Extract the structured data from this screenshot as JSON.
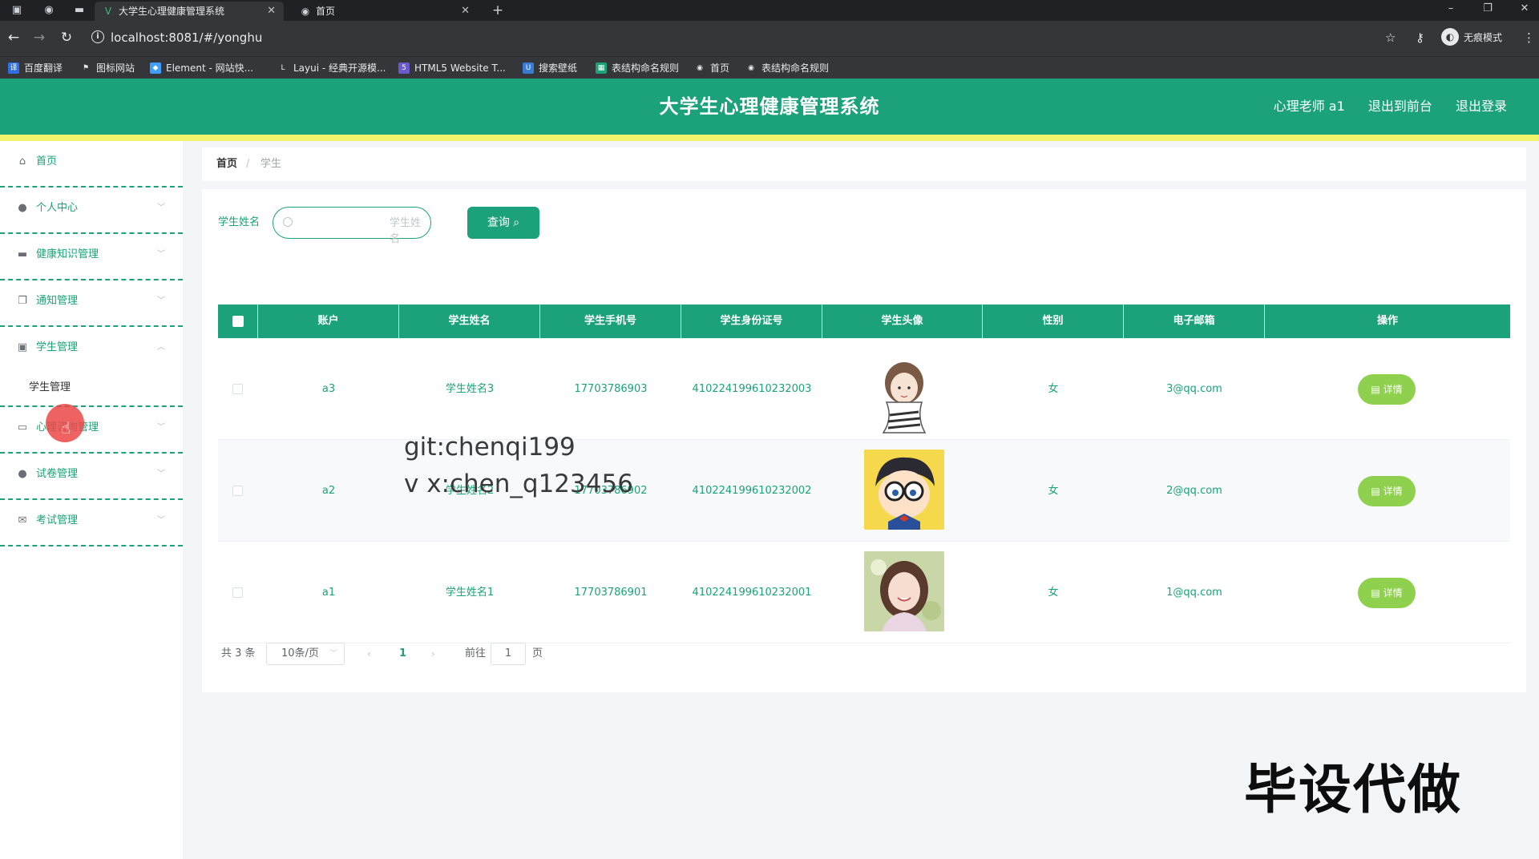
{
  "browser": {
    "tabs": [
      {
        "title": "大学生心理健康管理系统",
        "active": true
      },
      {
        "title": "首页",
        "active": false
      }
    ],
    "url": "localhost:8081/#/yonghu",
    "incognito_label": "无痕模式",
    "bookmarks": [
      "百度翻译",
      "图标网站",
      "Element - 网站快...",
      "Layui - 经典开源模...",
      "HTML5 Website T...",
      "搜索壁纸",
      "表结构命名规则",
      "首页",
      "表结构命名规则"
    ]
  },
  "header": {
    "title": "大学生心理健康管理系统",
    "user": "心理老师 a1",
    "to_front": "退出到前台",
    "logout": "退出登录"
  },
  "sidebar": {
    "items": [
      {
        "label": "首页",
        "icon": "home-icon"
      },
      {
        "label": "个人中心",
        "icon": "user-icon"
      },
      {
        "label": "健康知识管理",
        "icon": "monitor-icon"
      },
      {
        "label": "通知管理",
        "icon": "copy-icon"
      },
      {
        "label": "学生管理",
        "icon": "clipboard-icon"
      },
      {
        "label": "心理咨询管理",
        "icon": "chat-icon"
      },
      {
        "label": "试卷管理",
        "icon": "user-icon"
      },
      {
        "label": "考试管理",
        "icon": "mail-icon"
      }
    ],
    "sub_item": "学生管理"
  },
  "breadcrumb": {
    "home": "首页",
    "separator": "/",
    "current": "学生"
  },
  "search": {
    "label": "学生姓名",
    "placeholder": "学生姓名",
    "button": "查询"
  },
  "table": {
    "headers": [
      "账户",
      "学生姓名",
      "学生手机号",
      "学生身份证号",
      "学生头像",
      "性别",
      "电子邮箱",
      "操作"
    ],
    "rows": [
      {
        "account": "a3",
        "name": "学生姓名3",
        "phone": "17703786903",
        "id_card": "410224199610232003",
        "gender": "女",
        "email": "3@qq.com",
        "action": "详情"
      },
      {
        "account": "a2",
        "name": "学生姓名2",
        "phone": "17703786902",
        "id_card": "410224199610232002",
        "gender": "女",
        "email": "2@qq.com",
        "action": "详情"
      },
      {
        "account": "a1",
        "name": "学生姓名1",
        "phone": "17703786901",
        "id_card": "410224199610232001",
        "gender": "女",
        "email": "1@qq.com",
        "action": "详情"
      }
    ]
  },
  "pagination": {
    "total": "共 3 条",
    "page_size": "10条/页",
    "current_page": "1",
    "goto_label": "前往",
    "goto_value": "1",
    "goto_unit": "页"
  },
  "watermark": {
    "line1": "git:chenqi199",
    "line2": "v x:chen_q123456",
    "corner": "毕设代做"
  },
  "colors": {
    "primary": "#1ba27a",
    "accent_strip": "#f0f36b",
    "detail_button": "#8fd14f"
  }
}
